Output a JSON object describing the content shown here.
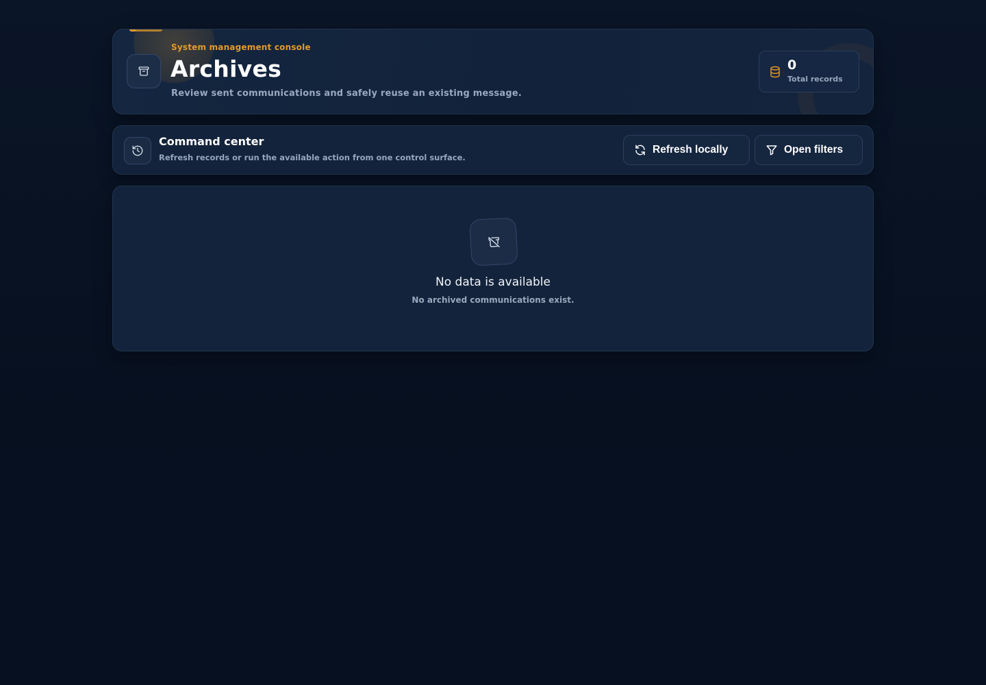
{
  "header": {
    "eyebrow": "System management console",
    "title": "Archives",
    "subtitle": "Review sent communications and safely reuse an existing message.",
    "icon": "archive-icon",
    "stat": {
      "value": "0",
      "label": "Total records",
      "icon": "database-icon"
    }
  },
  "command_center": {
    "icon": "history-icon",
    "title": "Command center",
    "subtitle": "Refresh records or run the available action from one control surface.",
    "buttons": {
      "refresh_label": "Refresh locally",
      "filters_label": "Open filters"
    }
  },
  "empty_state": {
    "icon": "archive-off-icon",
    "title": "No data is available",
    "subtitle": "No archived communications exist."
  },
  "colors": {
    "accent": "#e59a28",
    "background": "#07101f",
    "card": "#13233b",
    "muted_text": "#9aa8bd"
  }
}
